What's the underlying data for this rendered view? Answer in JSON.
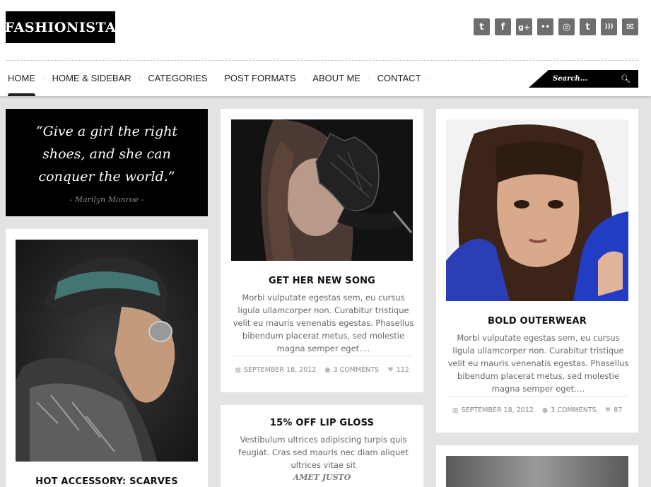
{
  "brand": {
    "logo_text": "FASHIONISTA"
  },
  "socials": [
    {
      "icon": "twitter-icon",
      "glyph": "t"
    },
    {
      "icon": "facebook-icon",
      "glyph": "f"
    },
    {
      "icon": "google-plus-icon",
      "glyph": "g+"
    },
    {
      "icon": "flickr-icon",
      "glyph": "••"
    },
    {
      "icon": "dribbble-icon",
      "glyph": "◎"
    },
    {
      "icon": "tumblr-icon",
      "glyph": "t"
    },
    {
      "icon": "rss-icon",
      "glyph": ")))"
    },
    {
      "icon": "mail-icon",
      "glyph": "✉"
    }
  ],
  "nav": {
    "items": [
      "HOME",
      "HOME & SIDEBAR",
      "CATEGORIES",
      "POST FORMATS",
      "ABOUT ME",
      "CONTACT"
    ],
    "active_index": 0
  },
  "search": {
    "placeholder": "Search..."
  },
  "quote": {
    "text": "“Give a girl the right shoes, and she can conquer the world.”",
    "author": "- Marilyn Monroe -"
  },
  "posts": {
    "scarves": {
      "title": "HOT ACCESSORY: SCARVES"
    },
    "song": {
      "title": "GET HER NEW SONG",
      "excerpt": "Morbi vulputate egestas sem, eu cursus ligula ullamcorper non. Curabitur tristique velit eu mauris venenatis egestas. Phasellus bibendum placerat metus, sed molestie magna semper eget.…",
      "date": "SEPTEMBER 18, 2012",
      "comments": "3 COMMENTS",
      "likes": "112"
    },
    "outerwear": {
      "title": "BOLD OUTERWEAR",
      "excerpt": "Morbi vulputate egestas sem, eu cursus ligula ullamcorper non. Curabitur tristique velit eu mauris venenatis egestas. Phasellus bibendum placerat metus, sed molestie magna semper eget.…",
      "date": "SEPTEMBER 18, 2012",
      "comments": "3 COMMENTS",
      "likes": "87"
    },
    "lipgloss": {
      "title": "15% OFF LIP GLOSS",
      "excerpt": "Vestibulum ultrices adipiscing turpis quis feugiat. Cras sed mauris nec diam aliquet ultrices vitae sit",
      "author": "AMET JUSTO"
    }
  }
}
